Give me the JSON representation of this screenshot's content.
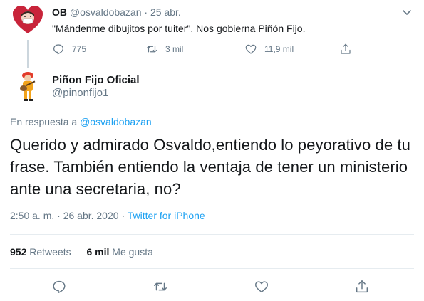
{
  "parent_tweet": {
    "name": "OB",
    "handle": "@osvaldobazan",
    "separator": "·",
    "date": "25 abr.",
    "text": "\"Mándenme dibujitos por tuiter\". Nos gobierna Piñón Fijo.",
    "actions": {
      "replies": "775",
      "retweets": "3 mil",
      "likes": "11,9 mil"
    }
  },
  "main_tweet": {
    "name": "Piñon Fijo Oficial",
    "handle": "@pinonfijo1",
    "replying_prefix": "En respuesta a",
    "replying_to": "@osvaldobazan",
    "text": "Querido y admirado Osvaldo,entiendo lo peyorativo de tu frase. También entiendo la ventaja de tener un ministerio ante una secretaria, no?",
    "time": "2:50 a. m. · 26 abr. 2020",
    "separator": "·",
    "source": "Twitter for iPhone",
    "stats": {
      "retweets_count": "952",
      "retweets_label": "Retweets",
      "likes_count": "6 mil",
      "likes_label": "Me gusta"
    }
  },
  "icons": {
    "reply": "reply-icon",
    "retweet": "retweet-icon",
    "like": "heart-icon",
    "share": "share-icon",
    "caret": "chevron-down-icon"
  },
  "colors": {
    "accent": "#1da1f2",
    "muted": "#657786",
    "text": "#14171a",
    "border": "#e6ecf0"
  }
}
